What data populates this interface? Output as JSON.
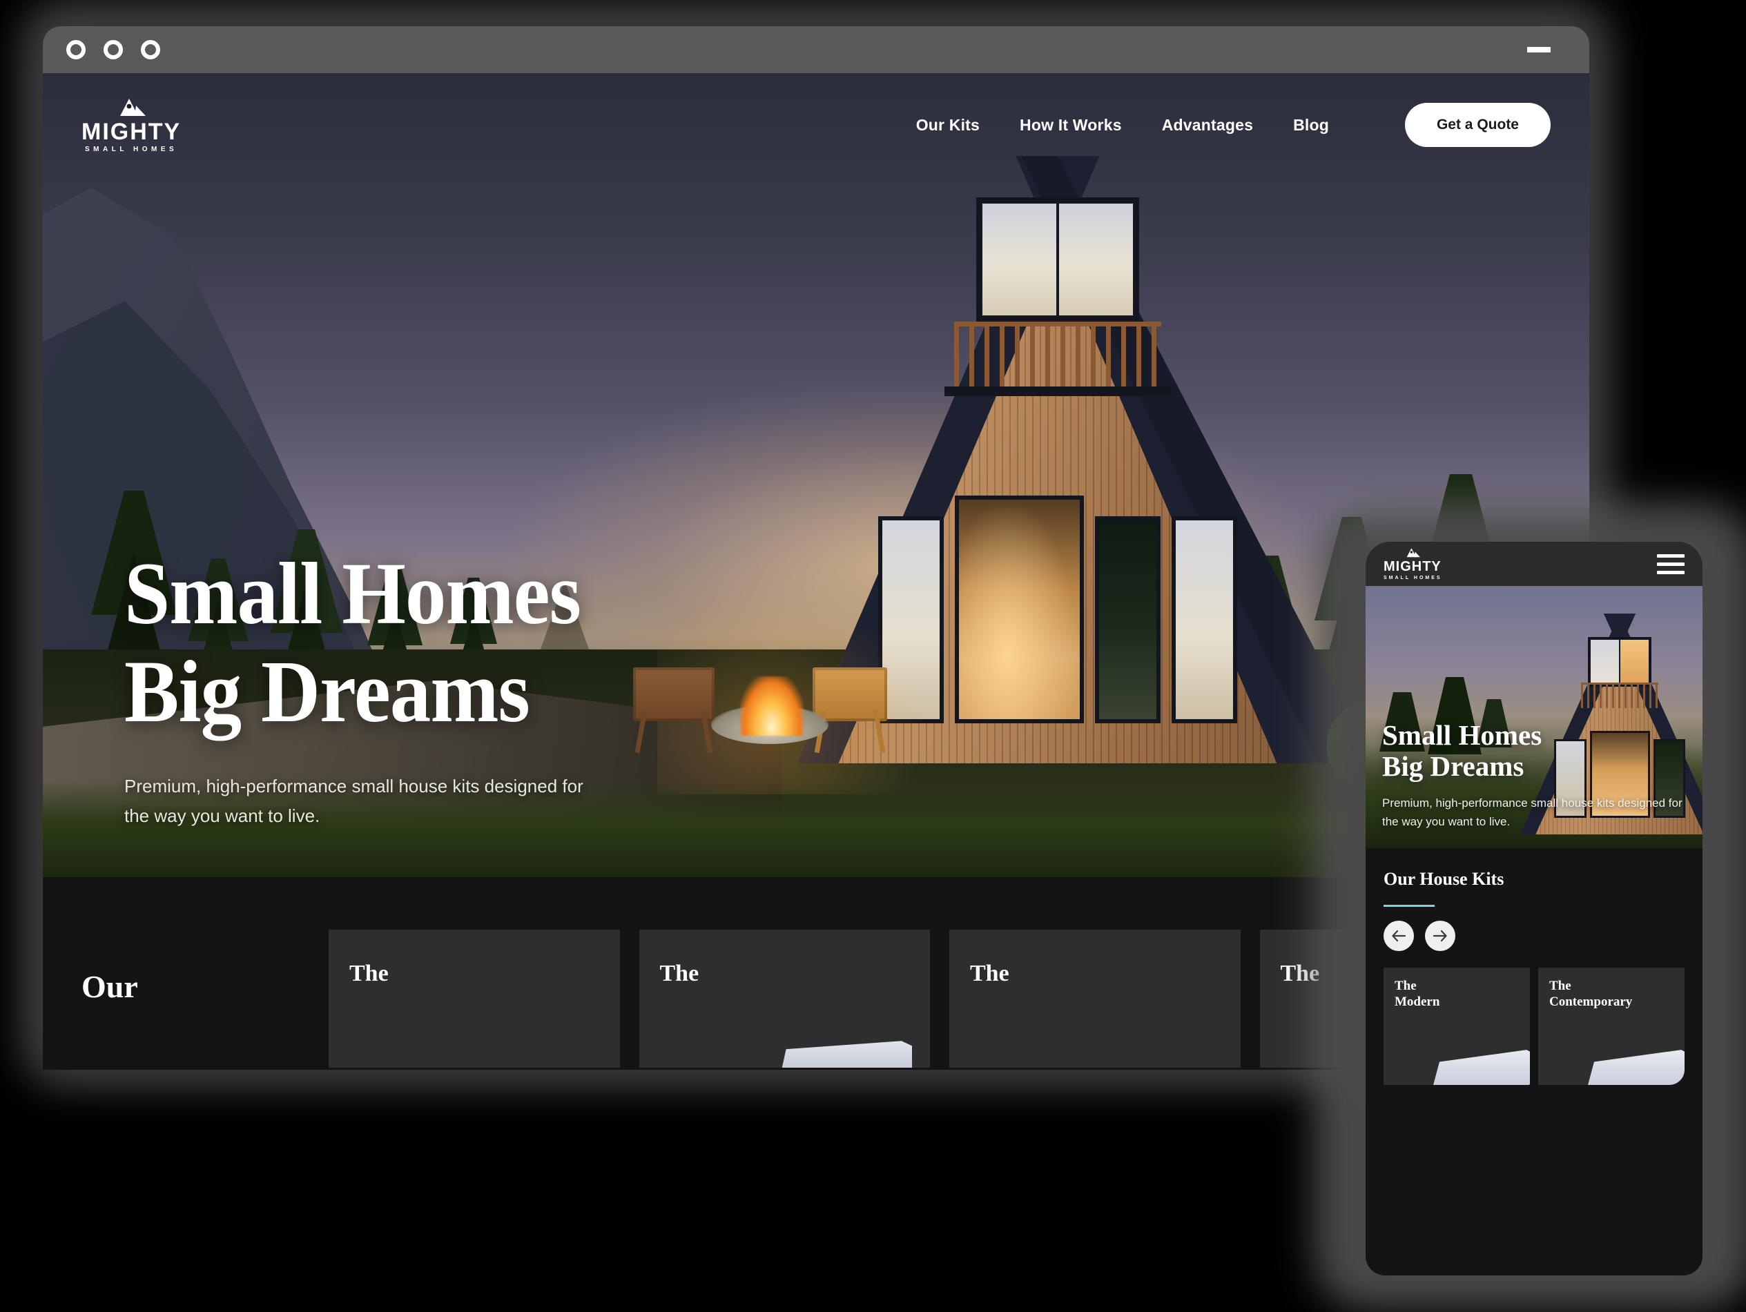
{
  "window": {
    "traffic_lights": [
      "close",
      "minimize",
      "zoom"
    ],
    "minimize_label": "—"
  },
  "brand": {
    "name": "MIGHTY",
    "tagline": "SMALL HOMES",
    "mark": "a-frame-cabin-icon"
  },
  "nav": {
    "items": [
      {
        "label": "Our Kits"
      },
      {
        "label": "How It Works"
      },
      {
        "label": "Advantages"
      },
      {
        "label": "Blog"
      }
    ],
    "cta_label": "Get a Quote"
  },
  "hero": {
    "headline_line1": "Small Homes",
    "headline_line2": "Big Dreams",
    "subhead": "Premium, high-performance small house kits designed for the way you want to live.",
    "scene": "a-frame-cabin-at-dusk-with-campfire"
  },
  "kits_desktop": {
    "section_title": "Our",
    "cards": [
      {
        "title": "The"
      },
      {
        "title": "The"
      },
      {
        "title": "The"
      },
      {
        "title": "The"
      }
    ]
  },
  "mobile": {
    "menu_icon": "hamburger-icon",
    "hero": {
      "headline_line1": "Small Homes",
      "headline_line2": "Big Dreams",
      "subhead": "Premium, high-performance small house kits designed for the way you want to live."
    },
    "kits": {
      "section_title": "Our House Kits",
      "prev_label": "←",
      "next_label": "→",
      "cards": [
        {
          "title_line1": "The",
          "title_line2": "Modern"
        },
        {
          "title_line1": "The",
          "title_line2": "Contemporary"
        }
      ]
    }
  },
  "colors": {
    "accent": "#7fd4da",
    "surface_dark": "#141414",
    "card": "#2e2e2e",
    "titlebar": "#5a5a5a",
    "mobile_bar": "#2b2b2b",
    "white": "#ffffff"
  }
}
